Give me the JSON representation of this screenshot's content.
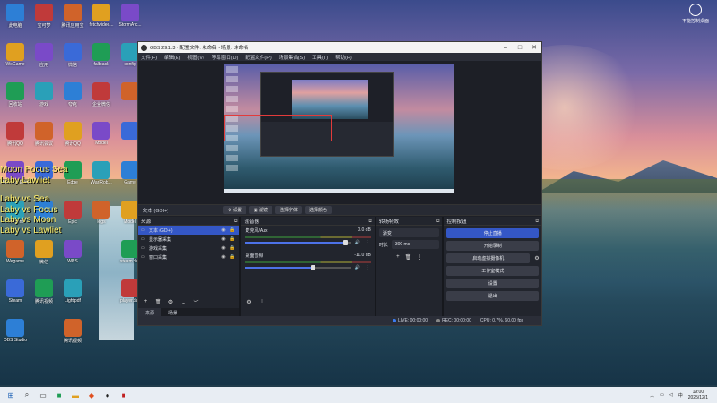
{
  "desktop": {
    "icons_col1": [
      "此电脑",
      "WeGame",
      "回收站",
      "腾讯QQ",
      "Microsoft Edge",
      "Tencent",
      "Wegame",
      "Steam",
      "OBS Studio"
    ],
    "icons_col2": [
      "宝可梦",
      "应用",
      "游戏",
      "腾讯会议",
      "",
      "",
      "微信",
      "腾讯视频"
    ],
    "icons_col3": [
      "腾讯应用宝",
      "微信",
      "夸克",
      "腾讯QQ",
      "Edge",
      "Epic",
      "WPS",
      "Lightpdf",
      "腾讯视频"
    ],
    "icons_col4": [
      "fetchvideo...",
      "fallback",
      "企业微信",
      "Model",
      "War.Rob...",
      "logs"
    ],
    "icons_col5": [
      "StormArc...",
      "config",
      "",
      "",
      "Game",
      "Model",
      "steam.dat",
      "player.dat"
    ],
    "overlay_lines": [
      "Moon Focus Sea",
      "Laby Lawliet",
      "Laby vs Sea",
      "Laby vs Focus",
      "Laby vs Moon",
      "Laby vs Lawliet"
    ],
    "right_widget_label": "不能控制桌面"
  },
  "obs": {
    "title": "OBS 29.1.3 - 配置文件: 未命名 - 场景: 未命名",
    "menu": [
      "文件(F)",
      "编辑(E)",
      "视图(V)",
      "停靠窗口(D)",
      "配置文件(P)",
      "场景集合(S)",
      "工具(T)",
      "帮助(H)"
    ],
    "source_toolbar": {
      "source_name": "文本 (GDI+)",
      "buttons": [
        "设置",
        "滤镜",
        "选择字体",
        "选择颜色"
      ]
    },
    "scenes": {
      "header": "来源",
      "items": [
        {
          "name": "文本 (GDI+)",
          "icon": "text-icon"
        },
        {
          "name": "显示器采集",
          "icon": "monitor-icon"
        },
        {
          "name": "游戏采集",
          "icon": "gamepad-icon"
        },
        {
          "name": "窗口采集",
          "icon": "window-icon"
        }
      ],
      "tabs": [
        "来源",
        "场景"
      ]
    },
    "mixer": {
      "header": "混音器",
      "channels": [
        {
          "name": "麦克风/Aux",
          "level": "0.0 dB",
          "volume": 0.95
        },
        {
          "name": "桌面音频",
          "level": "-11.0 dB",
          "volume": 0.65
        }
      ]
    },
    "transitions": {
      "header": "转场特效",
      "type": "渐变",
      "duration_label": "时长",
      "duration": "300 ms"
    },
    "controls": {
      "header": "控制按钮",
      "buttons": [
        "停止直播",
        "开始录制",
        "启动虚拟摄像机",
        "工作室模式",
        "设置",
        "退出"
      ]
    },
    "status": {
      "live": "LIVE: 00:00:00",
      "rec": "REC: 00:00:00",
      "cpu": "CPU: 0.7%, 60.00 fps"
    }
  },
  "taskbar": {
    "time": "19:00",
    "date": "2025/12/1"
  }
}
